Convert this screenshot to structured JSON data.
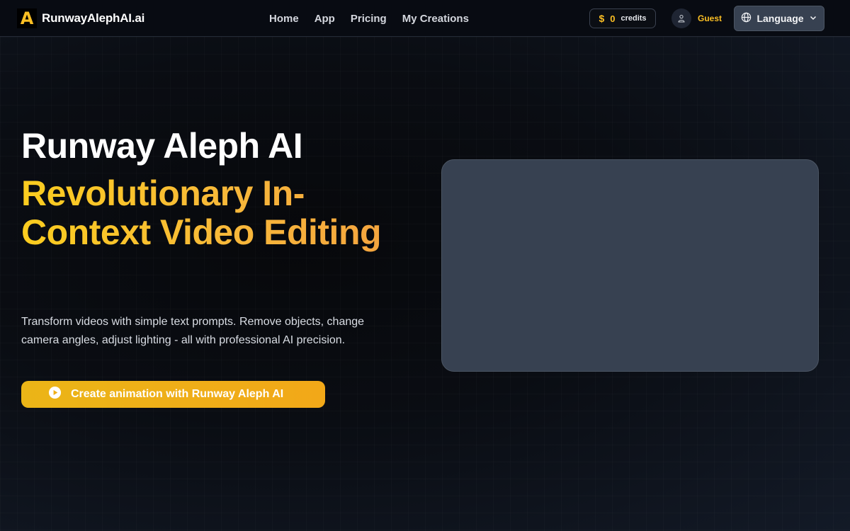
{
  "header": {
    "logo_letter": "A",
    "logo_text": "RunwayAlephAI.ai",
    "nav": [
      {
        "label": "Home"
      },
      {
        "label": "App"
      },
      {
        "label": "Pricing"
      },
      {
        "label": "My Creations"
      }
    ],
    "credits": {
      "icon": "dollar-icon",
      "amount": "0",
      "label": "credits"
    },
    "user": {
      "icon": "user-icon",
      "name": "Guest"
    },
    "language": {
      "label": "Language",
      "icon": "globe-icon",
      "chevron": "chevron-down-icon"
    }
  },
  "hero": {
    "title": "Runway Aleph AI",
    "subtitle": "Revolutionary In-Context Video Editing",
    "description": "Transform videos with simple text prompts. Remove objects, change camera angles, adjust lighting - all with professional AI precision.",
    "cta_label": "Create animation with Runway Aleph AI",
    "cta_icon": "play-circle-icon"
  },
  "colors": {
    "accent": "#fbbf24",
    "header_bg": "#080b12",
    "panel_bg": "#374151",
    "cta_start": "#ebb517",
    "cta_end": "#f2a818"
  }
}
